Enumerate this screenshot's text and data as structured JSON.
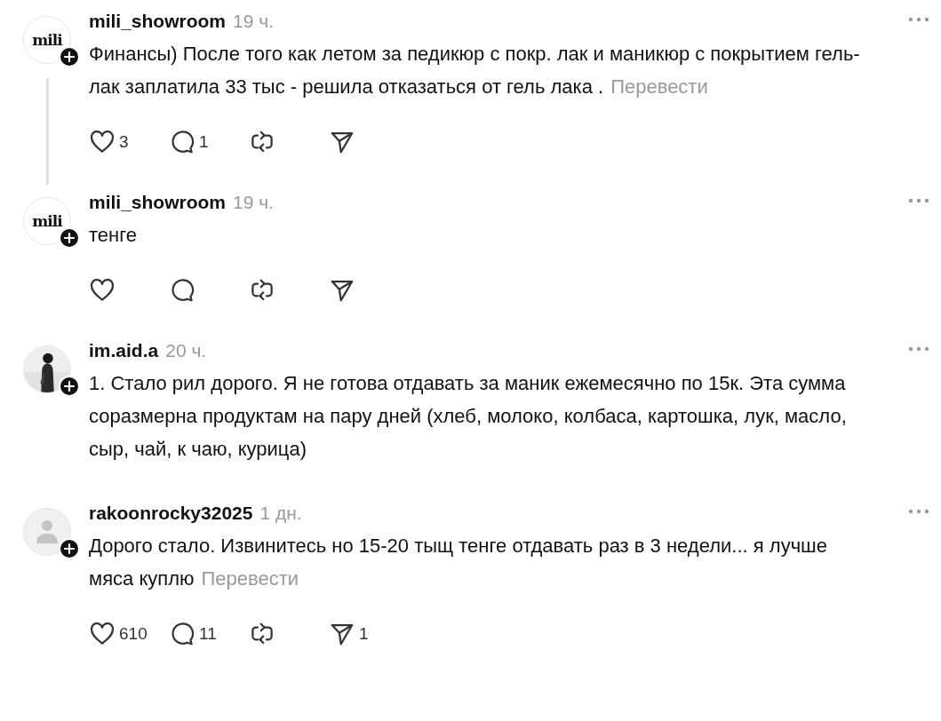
{
  "comments": [
    {
      "avatar": {
        "kind": "logo",
        "logo_text": "mili"
      },
      "thread_line": true,
      "username": "mili_showroom",
      "time": "19 ч.",
      "text": "Финансы) После того как летом за педикюр с покр. лак и маникюр с покрытием гель-лак заплатила 33 тыс - решила отказаться от гель лака .",
      "translate": "Перевести",
      "actions": [
        {
          "kind": "like",
          "count": "3"
        },
        {
          "kind": "reply",
          "count": "1"
        },
        {
          "kind": "repost"
        },
        {
          "kind": "share"
        }
      ]
    },
    {
      "avatar": {
        "kind": "logo",
        "logo_text": "mili"
      },
      "thread_line": false,
      "username": "mili_showroom",
      "time": "19 ч.",
      "text": "тенге",
      "actions": [
        {
          "kind": "like"
        },
        {
          "kind": "reply"
        },
        {
          "kind": "repost"
        },
        {
          "kind": "share"
        }
      ]
    },
    {
      "thread_line": false,
      "username": "im.aid.a",
      "time": "20 ч.",
      "text": "1. Стало рил дорого. Я не готова отдавать за маник ежемесячно по 15к. Эта сумма соразмерна продуктам на пару дней (хлеб, молоко, колбаса, картошка, лук, масло, сыр, чай, к чаю, курица)"
    },
    {
      "avatar": {
        "kind": "default"
      },
      "thread_line": false,
      "username": "rakoonrocky32025",
      "time": "1 дн.",
      "text": "Дорого стало. Извинитесь но 15-20 тыщ тенге отдавать раз в 3 недели... я лучше мяса куплю",
      "translate": "Перевести",
      "actions": [
        {
          "kind": "like",
          "count": "610"
        },
        {
          "kind": "reply",
          "count": "11"
        },
        {
          "kind": "repost"
        },
        {
          "kind": "share",
          "count": "1"
        }
      ]
    }
  ]
}
